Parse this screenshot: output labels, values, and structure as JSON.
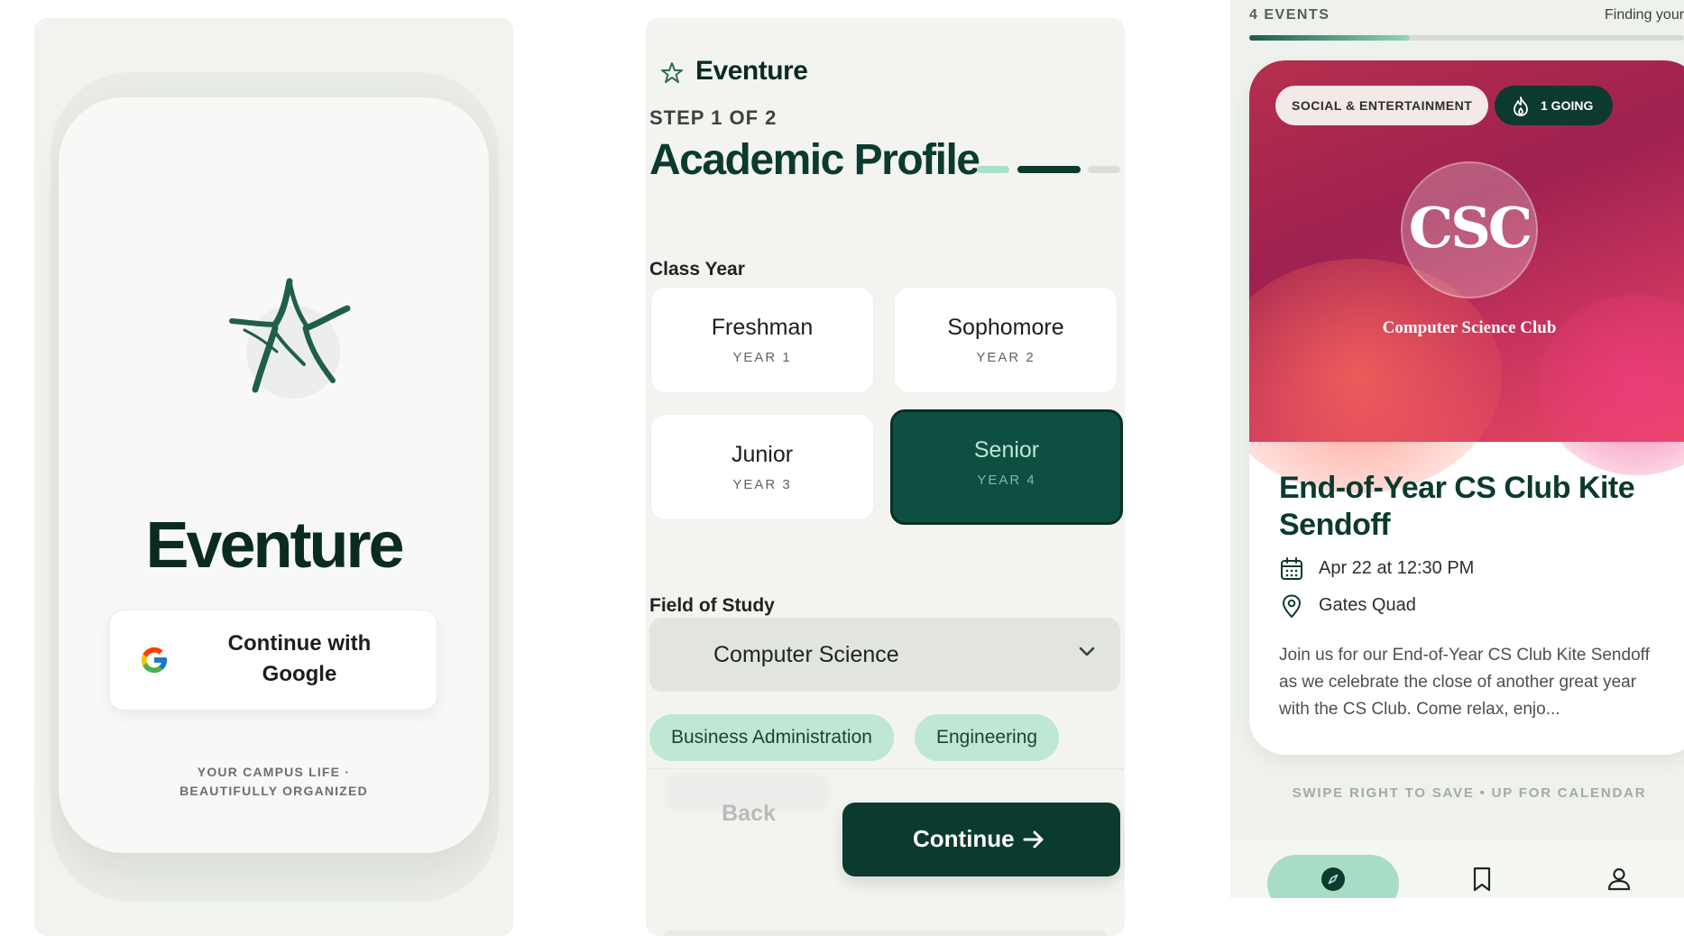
{
  "signin": {
    "brand": "Eventure",
    "google_button_label": "Continue with Google",
    "tagline": "YOUR CAMPUS LIFE · BEAUTIFULLY ORGANIZED",
    "logo_icon": "star-logo-icon",
    "google_icon": "google-g-icon"
  },
  "profile": {
    "header_title": "Eventure",
    "step": "STEP 1 OF 2",
    "title": "Academic Profile",
    "class_year_label": "Class Year",
    "class_years": [
      {
        "name": "Freshman",
        "year": "YEAR 1"
      },
      {
        "name": "Sophomore",
        "year": "YEAR 2"
      },
      {
        "name": "Junior",
        "year": "YEAR 3"
      },
      {
        "name": "Senior",
        "year": "YEAR 4",
        "selected": true
      }
    ],
    "field_label": "Field of Study",
    "field_value": "Computer Science",
    "suggestions": [
      "Business Administration",
      "Engineering"
    ],
    "back_label": "Back",
    "continue_label": "Continue",
    "colors": {
      "primary": "#0b3a2e",
      "selected": "#0d5041",
      "chip": "#bfe8d4"
    }
  },
  "feed": {
    "event_count": "4 EVENTS",
    "status_text": "Finding your",
    "progress_fraction": 0.37,
    "category_badge": "SOCIAL & ENTERTAINMENT",
    "going_badge": "1 GOING",
    "club_logo_text": "CSC",
    "club_name": "Computer Science Club",
    "event_title": "End-of-Year CS Club Kite Sendoff",
    "date_time": "Apr 22 at 12:30 PM",
    "location": "Gates Quad",
    "description": "Join us for our End-of-Year CS Club Kite Sendoff as we celebrate the close of another great year with the CS Club. Come relax, enjo...",
    "hint": "SWIPE RIGHT TO SAVE • UP FOR CALENDAR",
    "nav": [
      "explore-icon",
      "bookmark-icon",
      "profile-icon"
    ],
    "colors": {
      "hero_start": "#9e2150",
      "hero_end": "#ea4a62",
      "accent": "#0d3a2e"
    }
  }
}
